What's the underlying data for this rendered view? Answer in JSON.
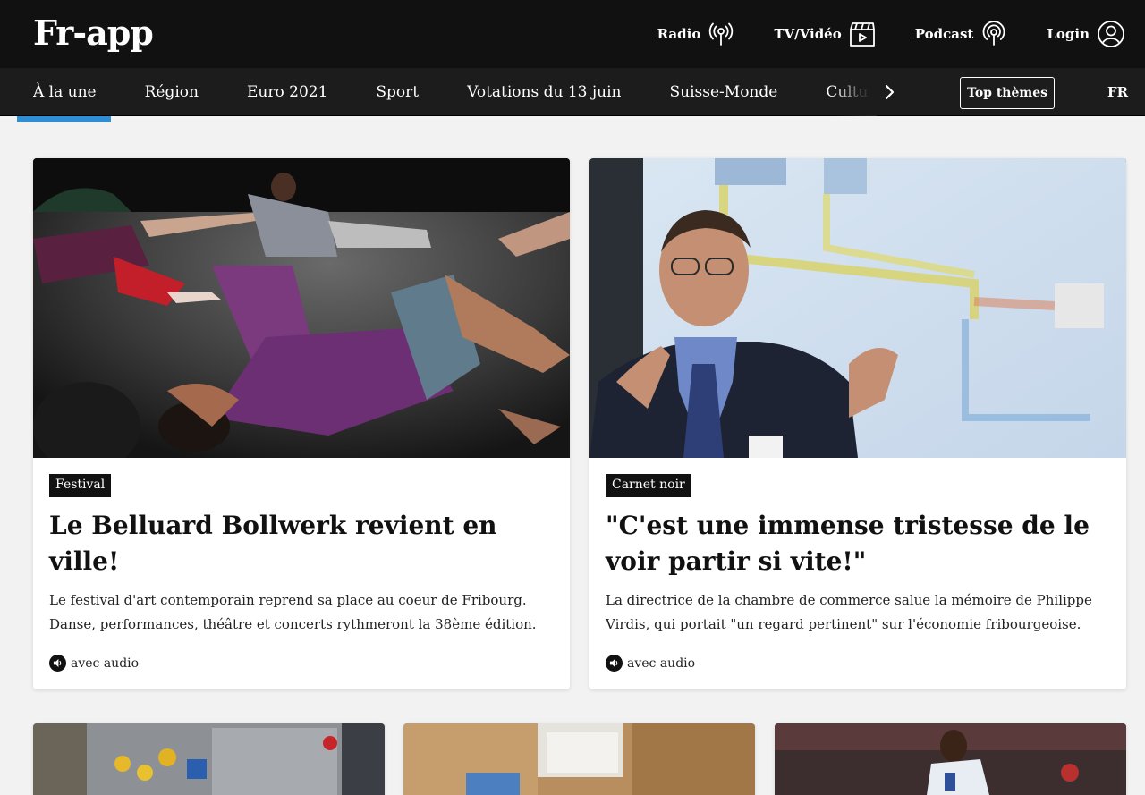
{
  "header": {
    "logo": "Fr-app",
    "links": [
      {
        "label": "Radio",
        "icon": "radio-icon"
      },
      {
        "label": "TV/Vidéo",
        "icon": "video-icon"
      },
      {
        "label": "Podcast",
        "icon": "podcast-icon"
      },
      {
        "label": "Login",
        "icon": "user-icon"
      }
    ]
  },
  "nav": {
    "items": [
      "À la une",
      "Région",
      "Euro 2021",
      "Sport",
      "Votations du 13 juin",
      "Suisse-Monde",
      "Culture"
    ],
    "active": "À la une",
    "top_themes": "Top thèmes",
    "lang": "FR"
  },
  "cards": [
    {
      "tag": "Festival",
      "title": "Le Belluard Bollwerk revient en ville!",
      "description": "Le festival d'art contemporain reprend sa place au coeur de Fribourg. Danse, performances, théâtre et concerts rythmeront la 38ème édition.",
      "audio": "avec audio"
    },
    {
      "tag": "Carnet noir",
      "title": "\"C'est une immense tristesse de le voir partir si vite!\"",
      "description": "La directrice de la chambre de commerce salue la mémoire de Philippe Virdis, qui portait \"un regard pertinent\" sur l'économie fribourgeoise.",
      "audio": "avec audio"
    }
  ],
  "colors": {
    "header_bg": "#111111",
    "nav_bg": "#1c1c1c",
    "active_accent": "#2f8fd5",
    "page_bg": "#f2f2f2"
  }
}
